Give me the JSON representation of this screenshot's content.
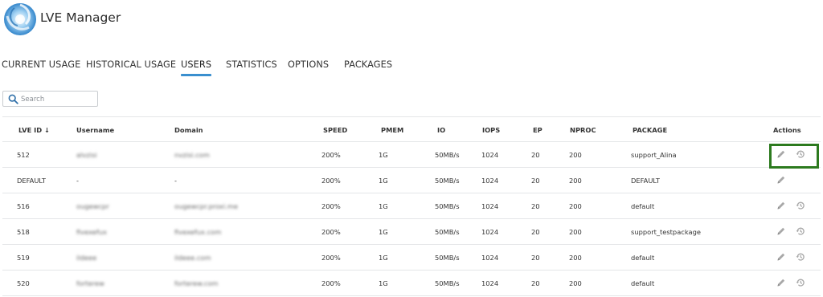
{
  "app": {
    "title": "LVE Manager"
  },
  "tabs": [
    {
      "label": "CURRENT USAGE"
    },
    {
      "label": "HISTORICAL USAGE"
    },
    {
      "label": "USERS"
    },
    {
      "label": "STATISTICS"
    },
    {
      "label": "OPTIONS"
    },
    {
      "label": "PACKAGES"
    }
  ],
  "active_tab": "USERS",
  "search": {
    "placeholder": "Search",
    "value": ""
  },
  "table": {
    "columns": [
      "LVE ID ↓",
      "Username",
      "Domain",
      "SPEED",
      "PMEM",
      "IO",
      "IOPS",
      "EP",
      "NPROC",
      "PACKAGE",
      "Actions"
    ],
    "rows": [
      {
        "lve_id": "512",
        "username": "alvzisi",
        "domain": "nvzisi.com",
        "speed": "200%",
        "pmem": "1G",
        "io": "50MB/s",
        "iops": "1024",
        "ep": "20",
        "nproc": "200",
        "package": "support_Alina",
        "actions": [
          "edit",
          "history"
        ]
      },
      {
        "lve_id": "DEFAULT",
        "username": "-",
        "domain": "-",
        "speed": "200%",
        "pmem": "1G",
        "io": "50MB/s",
        "iops": "1024",
        "ep": "20",
        "nproc": "200",
        "package": "DEFAULT",
        "actions": [
          "edit"
        ]
      },
      {
        "lve_id": "516",
        "username": "ougewcpr",
        "domain": "ougewcpr.proxi.me",
        "speed": "200%",
        "pmem": "1G",
        "io": "50MB/s",
        "iops": "1024",
        "ep": "20",
        "nproc": "200",
        "package": "default",
        "actions": [
          "edit",
          "history"
        ]
      },
      {
        "lve_id": "518",
        "username": "fivexefux",
        "domain": "fivexefux.com",
        "speed": "200%",
        "pmem": "1G",
        "io": "50MB/s",
        "iops": "1024",
        "ep": "20",
        "nproc": "200",
        "package": "support_testpackage",
        "actions": [
          "edit",
          "history"
        ]
      },
      {
        "lve_id": "519",
        "username": "ildeee",
        "domain": "ildeee.com",
        "speed": "200%",
        "pmem": "1G",
        "io": "50MB/s",
        "iops": "1024",
        "ep": "20",
        "nproc": "200",
        "package": "default",
        "actions": [
          "edit",
          "history"
        ]
      },
      {
        "lve_id": "520",
        "username": "forterew",
        "domain": "forterew.com",
        "speed": "200%",
        "pmem": "1G",
        "io": "50MB/s",
        "iops": "1024",
        "ep": "20",
        "nproc": "200",
        "package": "default",
        "actions": [
          "edit",
          "history"
        ]
      }
    ]
  },
  "icons": {
    "logo": "lve-logo-icon",
    "search": "search-icon",
    "edit": "pencil-icon",
    "history": "history-icon"
  },
  "colors": {
    "accent": "#3a8fcf",
    "highlight": "#2c7a1e",
    "icon": "#a8a8a8"
  }
}
